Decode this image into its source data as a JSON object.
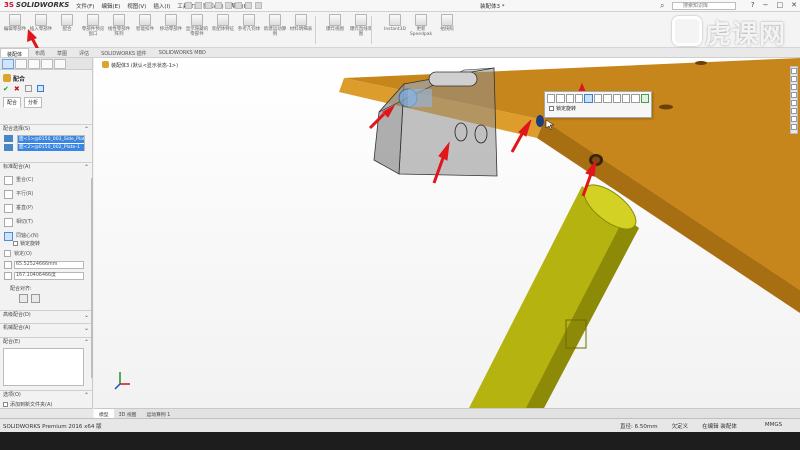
{
  "app": {
    "logo_prefix": "3S",
    "logo_text": "SOLIDWORKS",
    "document_title": "装配体3 *",
    "search_placeholder": "搜索知识库",
    "watermark_text": "虎课网"
  },
  "menu": [
    "文件(F)",
    "编辑(E)",
    "视图(V)",
    "插入(I)",
    "工具(T)",
    "窗口(W)",
    "帮助(H)"
  ],
  "window_controls": [
    "?",
    "−",
    "□",
    "✕"
  ],
  "ribbon_buttons": [
    {
      "label": "编辑零部件",
      "icon": "edit-component-icon"
    },
    {
      "label": "插入零部件",
      "icon": "insert-component-icon"
    },
    {
      "label": "配合",
      "icon": "mate-icon"
    },
    {
      "label": "零部件预览窗口",
      "icon": "preview-window-icon"
    },
    {
      "label": "线性零部件阵列",
      "icon": "linear-pattern-icon"
    },
    {
      "label": "智能扣件",
      "icon": "smart-fastener-icon"
    },
    {
      "label": "移动零部件",
      "icon": "move-component-icon"
    },
    {
      "label": "显示隐藏的零部件",
      "icon": "show-hidden-icon"
    },
    {
      "label": "装配体特征",
      "icon": "assembly-feature-icon"
    },
    {
      "label": "参考几何体",
      "icon": "reference-geometry-icon"
    },
    {
      "label": "新建运动算例",
      "icon": "motion-study-icon"
    },
    {
      "label": "材料明细表",
      "icon": "bom-icon"
    },
    {
      "label": "爆炸视图",
      "icon": "exploded-view-icon"
    },
    {
      "label": "爆炸直线草图",
      "icon": "explode-line-icon"
    },
    {
      "label": "Instant3D",
      "icon": "instant3d-icon"
    },
    {
      "label": "更新Speedpak",
      "icon": "speedpak-icon"
    },
    {
      "label": "拍快照",
      "icon": "snapshot-icon"
    }
  ],
  "cm_tabs": [
    "装配体",
    "布局",
    "草图",
    "评估",
    "SOLIDWORKS 插件",
    "SOLIDWORKS MBD"
  ],
  "property_manager": {
    "title": "配合",
    "subtab_mates": "配合",
    "subtab_analysis": "分析",
    "groups": {
      "selections": "配合选择(S)",
      "standard": "标准配合(A)",
      "advanced": "高级配合(D)",
      "mechanical": "机械配合(A)",
      "mates": "配合(E)",
      "options": "选项(O)"
    },
    "selected_entities": [
      "面<1>@0150_003_Side_Plate-",
      "面<2>@0150_002_Plate-1"
    ],
    "standard_mates": [
      "重合(C)",
      "平行(R)",
      "垂直(P)",
      "相切(T)",
      "同轴心(N)"
    ],
    "lock_rotation_label": "锁定旋转",
    "lock_label": "锁定(O)",
    "distance_value": "65.52524666mm",
    "angle_value": "167.10406466度",
    "mate_alignment_label": "配合对齐:",
    "option_add_to_folder": "添加到新文件夹(A)"
  },
  "viewport": {
    "tree_flyout": "装配体3  (默认<显示状态-1>)",
    "popup_lock_label": "锁定旋转"
  },
  "bottom_tabs": [
    "模型",
    "3D 视图",
    "运动算例 1"
  ],
  "status": {
    "left": "SOLIDWORKS Premium 2016 x64 版",
    "diameter": "直径: 6.50mm",
    "constraint": "欠定义",
    "mode": "在编辑 装配体",
    "units": "MMGS"
  },
  "colors": {
    "frame_orange": "#c7861b",
    "tube_yellow": "#b5b30f",
    "arrow_red": "#e0161b",
    "selection_blue": "#3a86e0"
  }
}
